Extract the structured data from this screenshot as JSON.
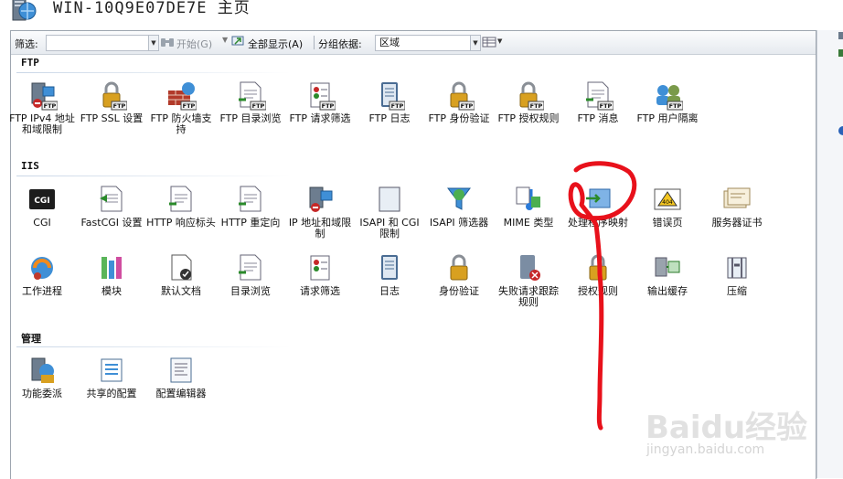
{
  "window": {
    "title": "WIN-10Q9E07DE7E 主页"
  },
  "toolbar": {
    "filter_label": "筛选:",
    "go_label": "开始(G)",
    "show_all_label": "全部显示(A)",
    "group_by_label": "分组依据:",
    "group_by_value": "区域"
  },
  "sections": {
    "ftp": {
      "title": "FTP",
      "items": [
        {
          "label": "FTP IPv4 地址和域限制",
          "icon": "ftp-ip-restrictions-icon"
        },
        {
          "label": "FTP SSL 设置",
          "icon": "ftp-ssl-lock-icon"
        },
        {
          "label": "FTP 防火墙支持",
          "icon": "ftp-firewall-icon"
        },
        {
          "label": "FTP 目录浏览",
          "icon": "ftp-directory-browsing-icon"
        },
        {
          "label": "FTP 请求筛选",
          "icon": "ftp-request-filtering-icon"
        },
        {
          "label": "FTP 日志",
          "icon": "ftp-logging-icon"
        },
        {
          "label": "FTP 身份验证",
          "icon": "ftp-authentication-icon"
        },
        {
          "label": "FTP 授权规则",
          "icon": "ftp-authorization-icon"
        },
        {
          "label": "FTP 消息",
          "icon": "ftp-messages-icon"
        },
        {
          "label": "FTP 用户隔离",
          "icon": "ftp-user-isolation-icon"
        }
      ]
    },
    "iis": {
      "title": "IIS",
      "row1": [
        {
          "label": "CGI",
          "icon": "cgi-icon"
        },
        {
          "label": "FastCGI 设置",
          "icon": "fastcgi-icon"
        },
        {
          "label": "HTTP 响应标头",
          "icon": "http-response-headers-icon"
        },
        {
          "label": "HTTP 重定向",
          "icon": "http-redirect-icon"
        },
        {
          "label": "IP 地址和域限制",
          "icon": "ip-restrictions-icon"
        },
        {
          "label": "ISAPI 和 CGI 限制",
          "icon": "isapi-cgi-restrictions-icon"
        },
        {
          "label": "ISAPI 筛选器",
          "icon": "isapi-filters-icon"
        },
        {
          "label": "MIME 类型",
          "icon": "mime-types-icon"
        },
        {
          "label": "处理程序映射",
          "icon": "handler-mappings-icon"
        },
        {
          "label": "错误页",
          "icon": "error-pages-icon"
        },
        {
          "label": "服务器证书",
          "icon": "server-certificates-icon"
        }
      ],
      "row2": [
        {
          "label": "工作进程",
          "icon": "worker-processes-icon"
        },
        {
          "label": "模块",
          "icon": "modules-icon"
        },
        {
          "label": "默认文档",
          "icon": "default-document-icon"
        },
        {
          "label": "目录浏览",
          "icon": "directory-browsing-icon"
        },
        {
          "label": "请求筛选",
          "icon": "request-filtering-icon"
        },
        {
          "label": "日志",
          "icon": "logging-icon"
        },
        {
          "label": "身份验证",
          "icon": "authentication-icon"
        },
        {
          "label": "失败请求跟踪规则",
          "icon": "failed-request-tracing-icon"
        },
        {
          "label": "授权规则",
          "icon": "authorization-rules-icon"
        },
        {
          "label": "输出缓存",
          "icon": "output-caching-icon"
        },
        {
          "label": "压缩",
          "icon": "compression-icon"
        }
      ]
    },
    "mgmt": {
      "title": "管理",
      "items": [
        {
          "label": "功能委派",
          "icon": "feature-delegation-icon"
        },
        {
          "label": "共享的配置",
          "icon": "shared-configuration-icon"
        },
        {
          "label": "配置编辑器",
          "icon": "configuration-editor-icon"
        }
      ]
    }
  },
  "watermark": {
    "brand": "Baidu经验",
    "url": "jingyan.baidu.com"
  },
  "colors": {
    "annotation": "#e8111b",
    "section_line": "#c9d6e6"
  }
}
